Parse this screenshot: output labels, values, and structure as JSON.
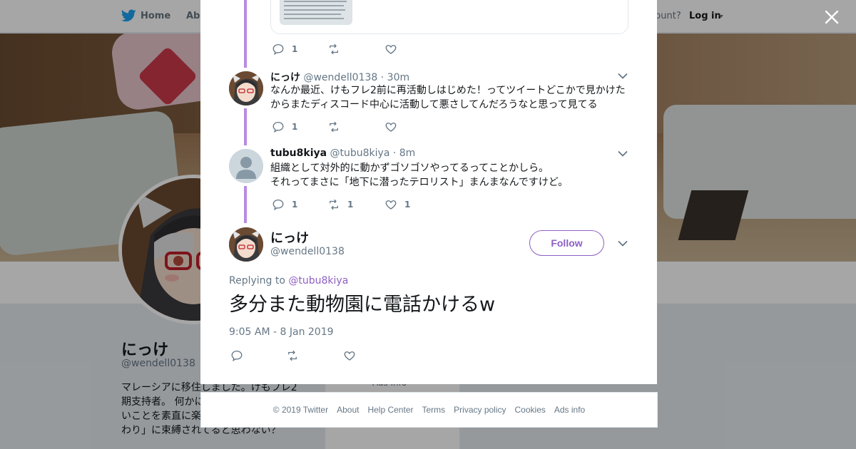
{
  "nav": {
    "home": "Home",
    "about": "Abo",
    "account": "ccount?",
    "login": "Log in"
  },
  "profile": {
    "name": "にっけ",
    "handle": "@wendell0138",
    "bio_lines": [
      "マレーシアに移住しました。けもフレ2",
      "期支持者。 何かに",
      "いことを素直に楽",
      "わり」に束縛されてると思わない？"
    ],
    "card_text": "Ads info"
  },
  "thread": [
    {
      "actions": {
        "reply": "1",
        "retweet": "",
        "like": ""
      }
    },
    {
      "name": "にっけ",
      "handle": "@wendell0138",
      "time": "· 30m",
      "lines": [
        "なんか最近、けもフレ2前に再活動しはじめた！ってツイートどこかで見かけた",
        "からまたディスコード中心に活動して悪さしてんだろうなと思って見てる"
      ],
      "actions": {
        "reply": "1",
        "retweet": "",
        "like": ""
      }
    },
    {
      "name": "tubu8kiya",
      "handle": "@tubu8kiya",
      "time": "· 8m",
      "lines": [
        "組織として対外的に動かずゴソゴソやってるってことかしら。",
        "それってまさに「地下に潜ったテロリスト」まんまなんですけど。"
      ],
      "actions": {
        "reply": "1",
        "retweet": "1",
        "like": "1"
      }
    }
  ],
  "main_tweet": {
    "name": "にっけ",
    "handle": "@wendell0138",
    "follow_label": "Follow",
    "replying_prefix": "Replying to ",
    "replying_to": "@tubu8kiya",
    "text": "多分また動物園に電話かけるw",
    "timestamp": "9:05 AM - 8 Jan 2019"
  },
  "footer": {
    "links": [
      "© 2019 Twitter",
      "About",
      "Help Center",
      "Terms",
      "Privacy policy",
      "Cookies",
      "Ads info"
    ]
  },
  "colors": {
    "accent": "#8e5fc4",
    "thread_line": "#b98ae3",
    "muted": "#657786",
    "twitter_blue": "#1da1f2"
  }
}
